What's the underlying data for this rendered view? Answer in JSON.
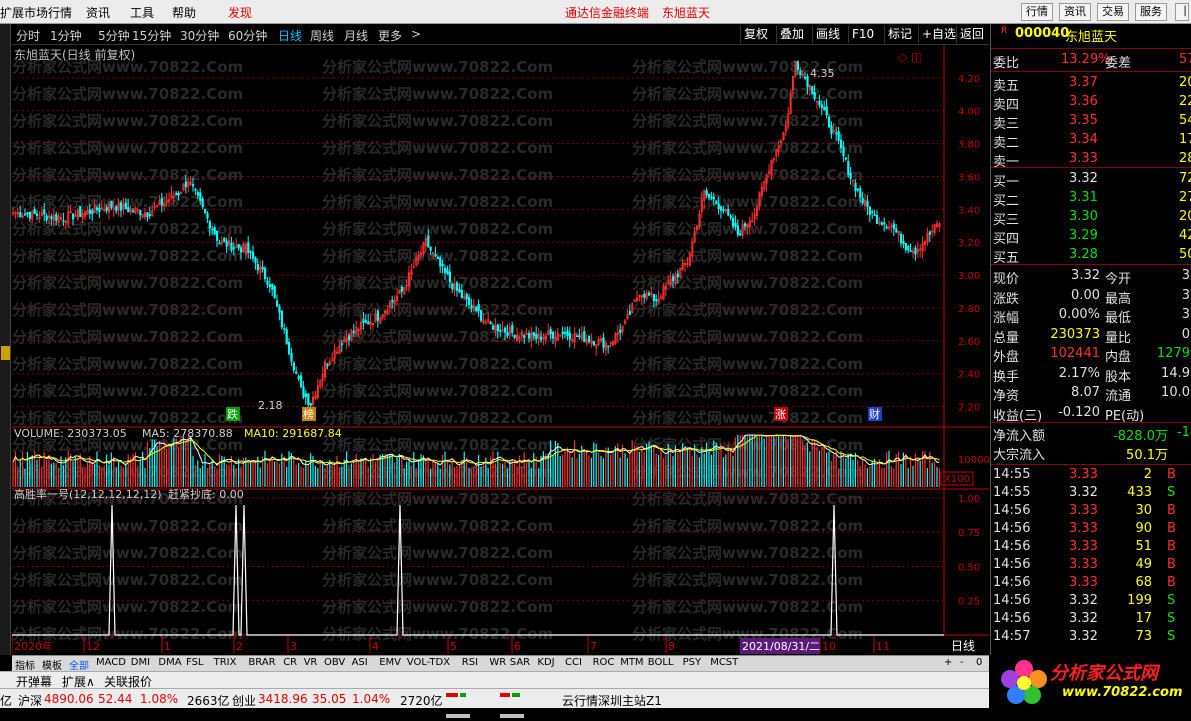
{
  "menu": {
    "items": [
      "扩展市场行情",
      "资讯",
      "工具",
      "帮助"
    ],
    "highlight": "发现",
    "banner": [
      "通达信金融终端",
      "东旭蓝天"
    ],
    "right_buttons": [
      "行情",
      "资讯",
      "交易",
      "服务"
    ]
  },
  "toolbar": {
    "periods": [
      "分时",
      "1分钟",
      "5分钟",
      "15分钟",
      "30分钟",
      "60分钟",
      "日线",
      "周线",
      "月线",
      "更多"
    ],
    "selected": "日线",
    "more_arrow": ">",
    "buttons": [
      "复权",
      "叠加",
      "画线",
      "F10",
      "标记",
      "+自选",
      "返回"
    ]
  },
  "chart": {
    "title": "东旭蓝天(日线 前复权)",
    "high_label": "4.35",
    "low_label": "2.18",
    "price_axis": [
      "4.20",
      "4.00",
      "3.80",
      "3.60",
      "3.40",
      "3.20",
      "3.00",
      "2.80",
      "2.60",
      "2.40",
      "2.20"
    ],
    "markers": [
      {
        "text": "跌",
        "color": "#00a000"
      },
      {
        "text": "榜",
        "color": "#c08000"
      },
      {
        "text": "涨",
        "color": "#c00000"
      },
      {
        "text": "财",
        "color": "#2040c0"
      }
    ],
    "volume_header": {
      "vol": "VOLUME: 230373.05",
      "ma5": "MA5: 278370.88",
      "ma10": "MA10: 291687.84"
    },
    "volume_axis": "10000",
    "volume_unit": "X100",
    "indicator_header": {
      "name": "高胜率一号(12,12,12,12,12)",
      "value": "赶紧抄底: 0.00"
    },
    "indicator_axis": [
      "1.00",
      "0.75",
      "0.50",
      "0.25"
    ],
    "date_labels": [
      "2020年",
      "12",
      "1",
      "2",
      "3",
      "4",
      "5",
      "6",
      "7",
      "8",
      "10",
      "11"
    ],
    "cursor_date": "2021/08/31/二",
    "period_label": "日线",
    "watermark": "分析家公式网www.70822.Com",
    "colors": {
      "up": "#ff3030",
      "down": "#00ffff",
      "ma5": "#ffffff",
      "ma10": "#ffff00",
      "grid": "#800000",
      "axis": "#c00000"
    }
  },
  "quote": {
    "code": "000040",
    "name": "东旭蓝天",
    "badge": "R",
    "wb": {
      "label": "委比",
      "value": "13.29%",
      "label2": "委差",
      "value2": "57"
    },
    "sells": [
      {
        "label": "卖五",
        "price": "3.37",
        "vol": "20"
      },
      {
        "label": "卖四",
        "price": "3.36",
        "vol": "22"
      },
      {
        "label": "卖三",
        "price": "3.35",
        "vol": "54"
      },
      {
        "label": "卖二",
        "price": "3.34",
        "vol": "17"
      },
      {
        "label": "卖一",
        "price": "3.33",
        "vol": "28"
      }
    ],
    "buys": [
      {
        "label": "买一",
        "price": "3.32",
        "vol": "72"
      },
      {
        "label": "买二",
        "price": "3.31",
        "vol": "27"
      },
      {
        "label": "买三",
        "price": "3.30",
        "vol": "20"
      },
      {
        "label": "买四",
        "price": "3.29",
        "vol": "42"
      },
      {
        "label": "买五",
        "price": "3.28",
        "vol": "50"
      }
    ],
    "stats": [
      {
        "l1": "现价",
        "v1": "3.32",
        "l2": "今开",
        "v2": "3"
      },
      {
        "l1": "涨跌",
        "v1": "0.00",
        "l2": "最高",
        "v2": "3"
      },
      {
        "l1": "涨幅",
        "v1": "0.00%",
        "l2": "最低",
        "v2": "3"
      },
      {
        "l1": "总量",
        "v1": "230373",
        "l2": "量比",
        "v2": "0"
      },
      {
        "l1": "外盘",
        "v1": "102441",
        "l2": "内盘",
        "v2": "1279"
      },
      {
        "l1": "换手",
        "v1": "2.17%",
        "l2": "股本",
        "v2": "14.9"
      },
      {
        "l1": "净资",
        "v1": "8.07",
        "l2": "流通",
        "v2": "10.0"
      },
      {
        "l1": "收益(三)",
        "v1": "-0.120",
        "l2": "PE(动)",
        "v2": ""
      }
    ],
    "flows": [
      {
        "label": "净流入额",
        "value": "-828.0万",
        "extra": "-1"
      },
      {
        "label": "大宗流入",
        "value": "50.1万",
        "extra": ""
      }
    ],
    "ticks": [
      {
        "time": "14:55",
        "price": "3.33",
        "vol": "2",
        "side": "B"
      },
      {
        "time": "14:55",
        "price": "3.32",
        "vol": "433",
        "side": "S"
      },
      {
        "time": "14:56",
        "price": "3.33",
        "vol": "30",
        "side": "B"
      },
      {
        "time": "14:56",
        "price": "3.33",
        "vol": "90",
        "side": "B"
      },
      {
        "time": "14:56",
        "price": "3.33",
        "vol": "51",
        "side": "B"
      },
      {
        "time": "14:56",
        "price": "3.33",
        "vol": "49",
        "side": "B"
      },
      {
        "time": "14:56",
        "price": "3.33",
        "vol": "68",
        "side": "B"
      },
      {
        "time": "14:56",
        "price": "3.32",
        "vol": "199",
        "side": "S"
      },
      {
        "time": "14:56",
        "price": "3.32",
        "vol": "17",
        "side": "S"
      },
      {
        "time": "14:57",
        "price": "3.32",
        "vol": "73",
        "side": "S"
      }
    ]
  },
  "indicator_tabs": {
    "items": [
      "指标",
      "模板",
      "全部",
      "MACD",
      "DMI",
      "DMA",
      "FSL",
      "TRIX",
      "BRAR",
      "CR",
      "VR",
      "OBV",
      "ASI",
      "EMV",
      "VOL-TDX",
      "RSI",
      "WR",
      "SAR",
      "KDJ",
      "CCI",
      "ROC",
      "MTM",
      "BOLL",
      "PSY",
      "MCST"
    ],
    "selected": "全部",
    "controls": [
      "+",
      "-",
      "0"
    ]
  },
  "bottom": {
    "items": [
      "开弹幕",
      "扩展∧",
      "关联报价"
    ]
  },
  "status": {
    "prefix": "亿",
    "index1_name": "沪深",
    "index1_value": "4890.06",
    "index1_chg": "52.44",
    "index1_pct": "1.08%",
    "index1_amt": "2663亿",
    "index2_name": "创业",
    "index2_value": "3418.96",
    "index2_chg": "35.05",
    "index2_pct": "1.04%",
    "index2_amt": "2720亿",
    "server": "云行情深圳主站Z1"
  },
  "logo": {
    "text": "分析家公式网",
    "url": "www.70822.com"
  }
}
